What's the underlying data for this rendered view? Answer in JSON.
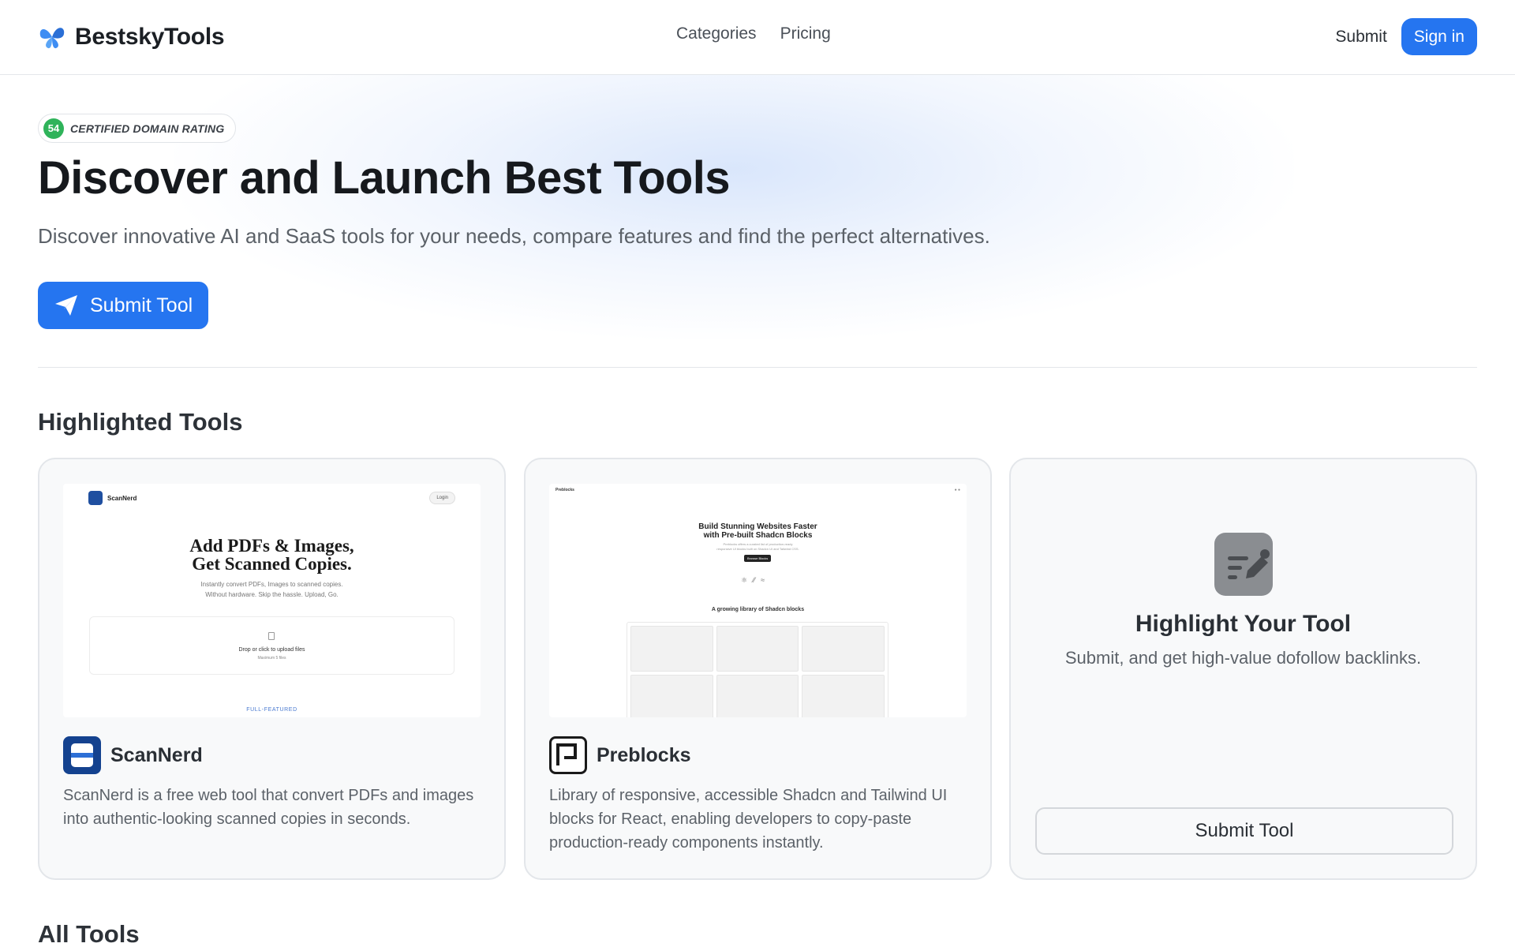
{
  "header": {
    "logo_text": "BestskyTools",
    "nav": [
      "Categories",
      "Pricing"
    ],
    "submit_label": "Submit",
    "signin_label": "Sign in"
  },
  "hero": {
    "badge_number": "54",
    "badge_text": "CERTIFIED DOMAIN RATING",
    "title": "Discover and Launch Best Tools",
    "subtitle": "Discover innovative AI and SaaS tools for your needs, compare features and find the perfect alternatives.",
    "cta_label": "Submit Tool"
  },
  "highlighted": {
    "title": "Highlighted Tools",
    "tools": [
      {
        "name": "ScanNerd",
        "description": "ScanNerd is a free web tool that convert PDFs and images into authentic-looking scanned copies in seconds.",
        "screenshot": {
          "brand": "ScanNerd",
          "login": "Login",
          "headline": "Add PDFs & Images,\nGet Scanned Copies.",
          "sub": "Instantly convert PDFs, Images to scanned copies.\nWithout hardware. Skip the hassle. Upload, Go.",
          "drop_text": "Drop or click to upload files",
          "drop_sub": "Maximum 5 files",
          "feature": "FULL-FEATURED"
        }
      },
      {
        "name": "Preblocks",
        "description": "Library of responsive, accessible Shadcn and Tailwind UI blocks for React, enabling developers to copy-paste production-ready components instantly.",
        "screenshot": {
          "brand": "Preblocks",
          "title": "Build Stunning Websites Faster\nwith Pre-built Shadcn Blocks",
          "sub": "Preblocks offers a curated list of production-ready\nresponsive UI blocks built on Shadcn UI and Tailwind CSS.",
          "button": "Browse Blocks",
          "library": "A growing library of Shadcn blocks"
        }
      }
    ],
    "promo": {
      "title": "Highlight Your Tool",
      "subtitle": "Submit, and get high-value dofollow backlinks.",
      "button": "Submit Tool"
    }
  },
  "all_tools": {
    "title": "All Tools"
  },
  "colors": {
    "primary": "#2575f0",
    "badge_green": "#2fb35a",
    "scannerd_blue": "#1f4fa0"
  }
}
